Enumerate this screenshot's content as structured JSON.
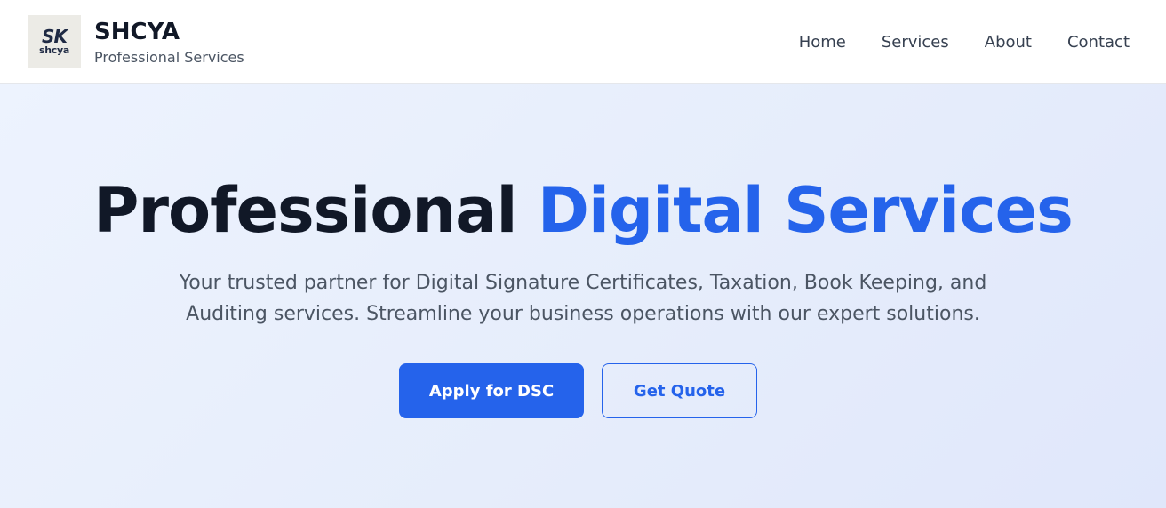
{
  "header": {
    "logo": {
      "mark": "SK",
      "word": "shcya"
    },
    "brand_name": "SHCYA",
    "brand_tagline": "Professional Services",
    "nav": [
      {
        "label": "Home"
      },
      {
        "label": "Services"
      },
      {
        "label": "About"
      },
      {
        "label": "Contact"
      }
    ]
  },
  "hero": {
    "title_part1": "Professional",
    "title_part2": "Digital Services",
    "subtitle": "Your trusted partner for Digital Signature Certificates, Taxation, Book Keeping, and Auditing services. Streamline your business operations with our expert solutions.",
    "primary_cta": "Apply for DSC",
    "secondary_cta": "Get Quote"
  },
  "colors": {
    "accent": "#2563eb",
    "heading": "#111827",
    "body_text": "#4b5563",
    "hero_bg": "#e8eefc"
  }
}
